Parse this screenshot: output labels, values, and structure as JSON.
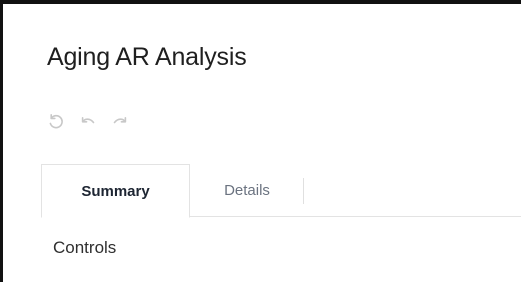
{
  "page": {
    "title": "Aging AR Analysis"
  },
  "toolbar": {
    "buttons": [
      {
        "icon": "reset-icon"
      },
      {
        "icon": "undo-icon"
      },
      {
        "icon": "redo-icon"
      }
    ],
    "icon_color": "#c8c8c8"
  },
  "tabs": [
    {
      "label": "Summary",
      "active": true
    },
    {
      "label": "Details",
      "active": false
    }
  ],
  "main": {
    "section_label": "Controls"
  },
  "colors": {
    "title_text": "#1f1f1f",
    "active_tab_text": "#1d2532",
    "inactive_tab_text": "#6b7380",
    "border": "#e3e3e3"
  }
}
